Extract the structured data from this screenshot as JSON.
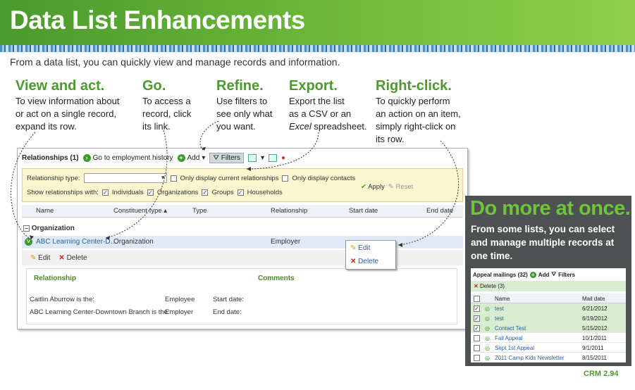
{
  "banner": {
    "title": "Data List Enhancements"
  },
  "intro": "From a data list, you can quickly view and manage records and information.",
  "tips": [
    {
      "title": "View and act.",
      "l1": "To view information about",
      "l2": "or act on a single record,",
      "l3": "expand its row."
    },
    {
      "title": "Go.",
      "l1": "To access a",
      "l2": "record, click",
      "l3": "its link."
    },
    {
      "title": "Refine.",
      "l1": "Use filters to",
      "l2": "see only what",
      "l3": "you want."
    },
    {
      "title": "Export.",
      "l1": "Export the list",
      "l2": "as a CSV or an",
      "l3a": "Excel",
      "l3b": " spreadsheet."
    },
    {
      "title": "Right-click.",
      "l1": "To quickly perform",
      "l2": "an action on an item,",
      "l3": "simply right-click on",
      "l4": "its row."
    }
  ],
  "panel": {
    "title": "Relationships (1)",
    "go": "Go to employment history",
    "add": "Add",
    "filters": "Filters",
    "filter": {
      "type_label": "Relationship type:",
      "current": "Only display current relationships",
      "contacts": "Only display contacts",
      "show": "Show relationships with:",
      "individuals": "Individuals",
      "organizations": "Organizations",
      "groups": "Groups",
      "households": "Households",
      "apply": "Apply",
      "reset": "Reset"
    },
    "columns": [
      "Name",
      "Constituent type ▴",
      "Type",
      "Relationship",
      "Start date",
      "End date"
    ],
    "group": "Organization",
    "row": {
      "name": "ABC Learning Center-D...",
      "ctype": "Organization",
      "rel": "Employer"
    },
    "edit": "Edit",
    "delete": "Delete",
    "detail": {
      "h1": "Relationship",
      "h2": "Comments",
      "r1a": "Caitlin Aburrow is the:",
      "r1b": "Employee",
      "r1c": "Start date:",
      "r2a": "ABC Learning Center-Downtown Branch is the:",
      "r2b": "Employer",
      "r2c": "End date:"
    },
    "ctx": {
      "edit": "Edit",
      "delete": "Delete"
    }
  },
  "more": {
    "title": "Do more at once.",
    "text": "From some lists, you can select and manage multiple records at one time.",
    "mini": {
      "title": "Appeal mailings (32)",
      "add": "Add",
      "filters": "Filters",
      "delete": "Delete (3)",
      "col_name": "Name",
      "col_date": "Mail date",
      "rows": [
        {
          "name": "test",
          "date": "6/21/2012"
        },
        {
          "name": "test",
          "date": "6/19/2012"
        },
        {
          "name": "Contact Test",
          "date": "5/15/2012"
        },
        {
          "name": "Fall Appeal",
          "date": "10/1/2011"
        },
        {
          "name": "Sept 1st Appeal",
          "date": "9/1/2011"
        },
        {
          "name": "2011 Camp Kids Newsletter",
          "date": "8/15/2011"
        }
      ]
    }
  },
  "footer": "CRM 2.94"
}
